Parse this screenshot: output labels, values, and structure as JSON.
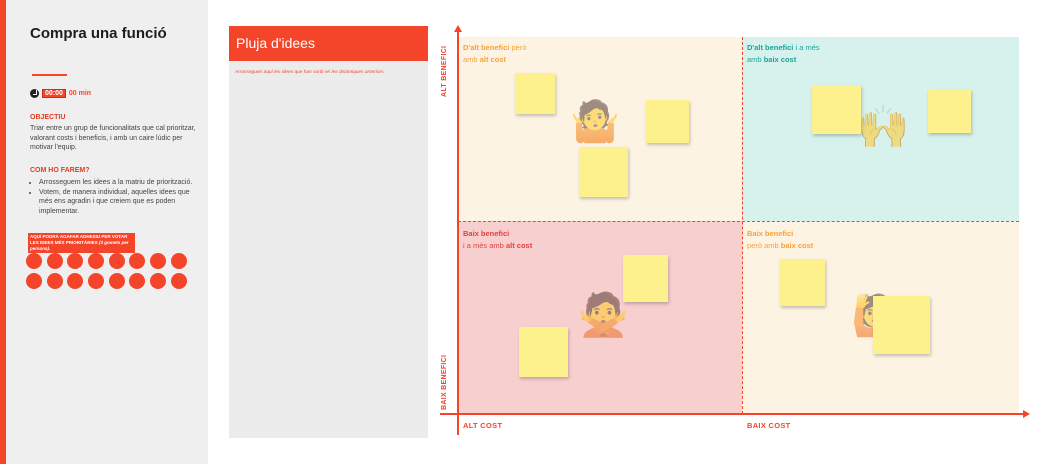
{
  "left_panel": {
    "title": "Compra una funció",
    "timer": {
      "value": "00:00",
      "unit": "00 min"
    },
    "objective": {
      "heading": "OBJECTIU",
      "text": "Triar entre un grup de funcionalitats que cal prioritzar, valorant costs i beneficis, i amb un caire lúdic per motivar l'equip."
    },
    "how": {
      "heading": "COM HO FAREM?",
      "steps": [
        "Arrosseguem les idees a la matriu de priorització.",
        "Votem, de manera individual, aquelles idees que més ens agradin i que creiem que es poden implementar."
      ]
    },
    "vote_label_main": "AQUÍ PODRÀ AGAFAR ADHESIU PER VOTAR LES IDEES MÉS PRIORITÀRIES",
    "vote_label_note": "(3 gomets per persona).",
    "vote_dots_count": 16
  },
  "brainstorm": {
    "title": "Pluja d'idees",
    "hint": "Arrosseguen aquí les idees que han sortit en les dinàmiques anteriors."
  },
  "matrix": {
    "y_axis_top": "ALT BENEFICI",
    "y_axis_bottom": "BAIX BENEFICI",
    "x_axis_left": "ALT COST",
    "x_axis_right": "BAIX COST",
    "quadrants": {
      "top_left": {
        "line1_strong": "D'alt benefici",
        "line1_rest": " però",
        "line2_plain": "amb ",
        "line2_strong": "alt cost",
        "color": "#f5a23a"
      },
      "top_right": {
        "line1_strong": "D'alt benefici",
        "line1_rest": " i a més",
        "line2_plain": "amb ",
        "line2_strong": "baix cost",
        "color": "#1aa596"
      },
      "bottom_left": {
        "line1_strong": "Baix benefici",
        "line1_rest": "",
        "line2_plain": "i a més amb ",
        "line2_strong": "alt cost",
        "color": "#e2403d"
      },
      "bottom_right": {
        "line1_strong": "Baix benefici",
        "line1_rest": "",
        "line2_plain": "però amb ",
        "line2_strong": "baix cost",
        "color": "#f5a23a"
      }
    },
    "emojis": {
      "top_left": "🤷",
      "top_right": "🙌",
      "bottom_left": "🙅",
      "bottom_right": "🙋"
    }
  },
  "colors": {
    "accent": "#f4452b",
    "sticky": "#fdf18d"
  }
}
